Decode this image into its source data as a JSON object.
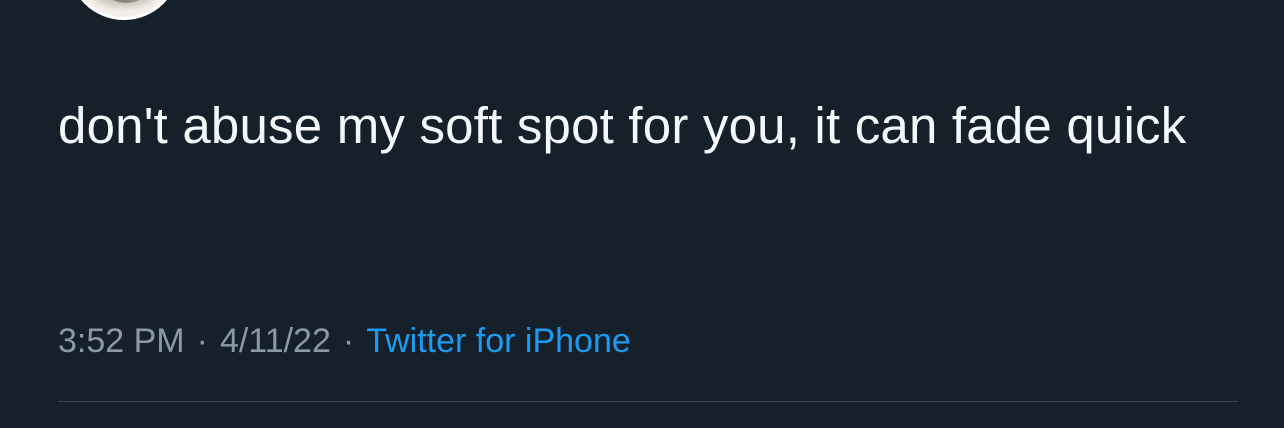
{
  "tweet": {
    "text": "don't abuse my soft spot for you, it can fade quick",
    "time": "3:52 PM",
    "separator": "·",
    "date": "4/11/22",
    "source": "Twitter for iPhone"
  },
  "colors": {
    "background": "#15202b",
    "text": "#f5f8fa",
    "meta": "#8b98a5",
    "link": "#1d9bf0",
    "divider": "#38444d"
  }
}
